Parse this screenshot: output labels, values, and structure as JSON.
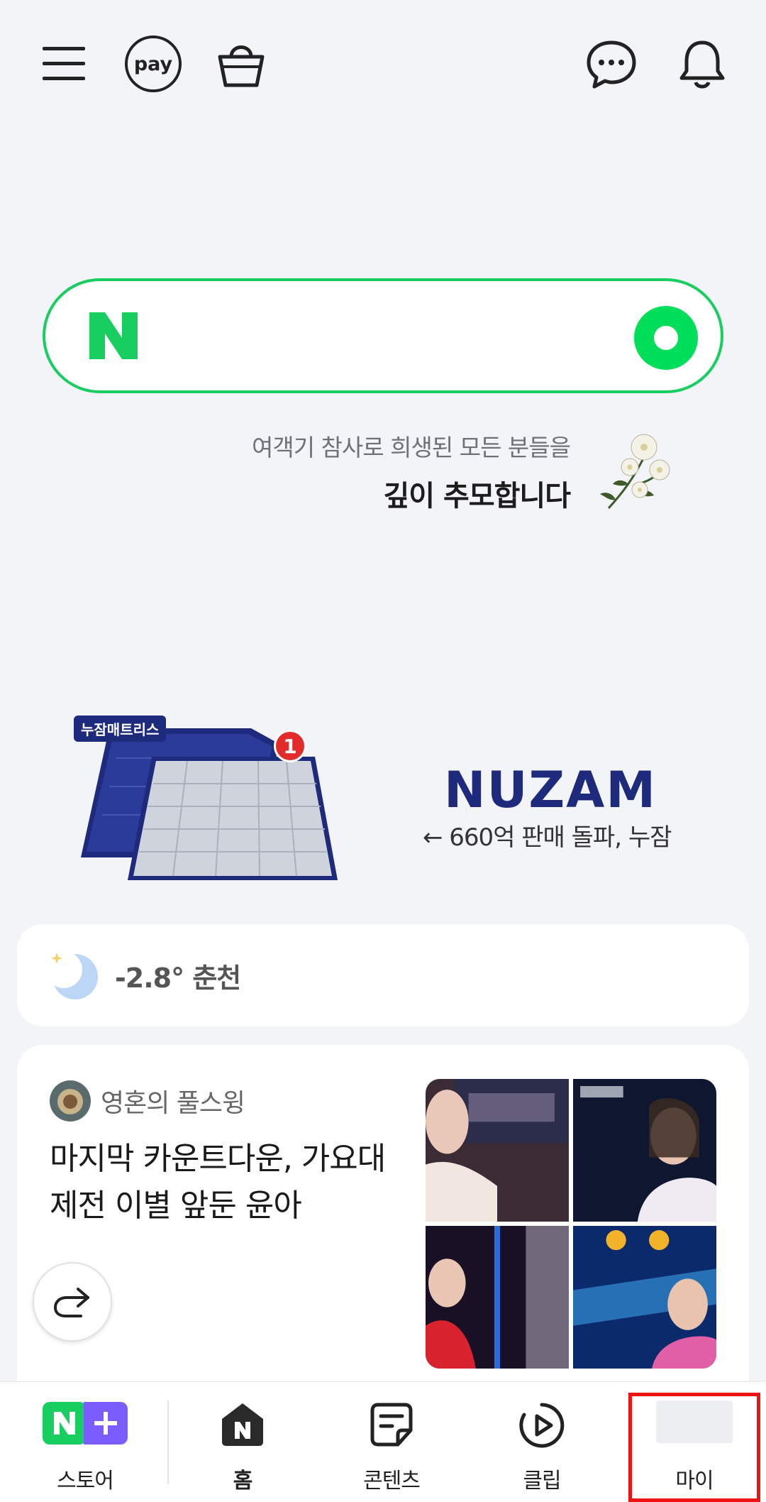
{
  "topbar": {
    "menu_icon": "hamburger-menu-icon",
    "pay_label": "pay",
    "cart_icon": "shopping-bag-icon",
    "chat_icon": "chat-bubble-icon",
    "bell_icon": "bell-icon"
  },
  "search": {
    "logo": "N",
    "value": "",
    "lens_icon": "green-lens-icon"
  },
  "memorial": {
    "line1": "여객기 참사로 희생된 모든 분들을",
    "line2": "깊이 추모합니다"
  },
  "ad": {
    "badge": "누잠매트리스",
    "badge_number": "1",
    "brand": "NUZAM",
    "tagline": "← 660억 판매 돌파, 누잠"
  },
  "weather": {
    "icon": "crescent-moon-icon",
    "text": "-2.8° 춘천"
  },
  "card": {
    "author": "영혼의 풀스윙",
    "title": "마지막 카운트다운, 가요대 제전 이별 앞둔 윤아",
    "share_icon": "share-arrow-icon"
  },
  "bottomnav": {
    "items": [
      {
        "label": "스토어",
        "icon": "n-plus-store-icon"
      },
      {
        "label": "홈",
        "icon": "n-home-icon"
      },
      {
        "label": "콘텐츠",
        "icon": "content-note-icon"
      },
      {
        "label": "클립",
        "icon": "clip-play-icon"
      },
      {
        "label": "마이",
        "icon": "my-profile-icon"
      }
    ]
  },
  "colors": {
    "brand_green": "#19ce60",
    "background": "#f2f4f7",
    "highlight": "#ef1414",
    "nuzam_navy": "#1e2a7c"
  }
}
